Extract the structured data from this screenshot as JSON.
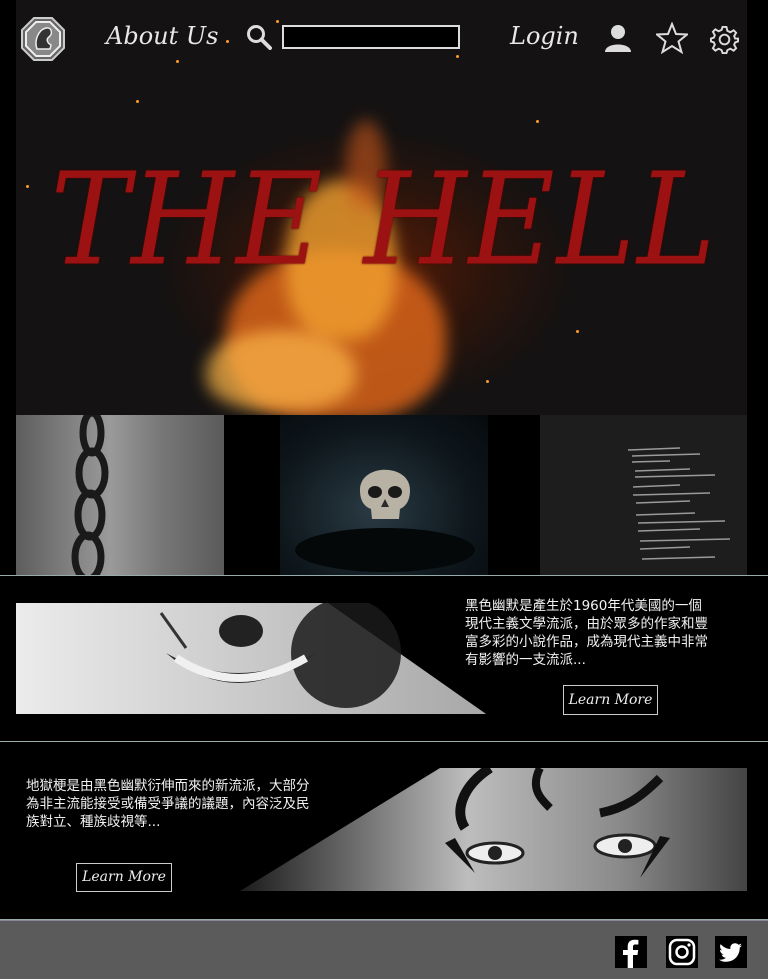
{
  "nav": {
    "about_label": "About Us",
    "search_placeholder": "",
    "login_label": "Login"
  },
  "hero": {
    "title": "THE HELL"
  },
  "promo1": {
    "text": "黑色幽默是產生於1960年代美國的一個現代主義文學流派，由於眾多的作家和豐富多彩的小說作品，成為現代主義中非常有影響的一支流派...",
    "button_label": "Learn More"
  },
  "promo2": {
    "text": "地獄梗是由黑色幽默衍伸而來的新流派，大部分為非主流能接受或備受爭議的議題，內容泛及民族對立、種族歧視等...",
    "button_label": "Learn More"
  },
  "colors": {
    "title_red": "#9c1212",
    "footer_gray": "#5b5b5b"
  },
  "icons": [
    "logo-icon",
    "search-icon",
    "user-icon",
    "star-icon",
    "gear-icon",
    "facebook-icon",
    "instagram-icon",
    "twitter-icon"
  ]
}
